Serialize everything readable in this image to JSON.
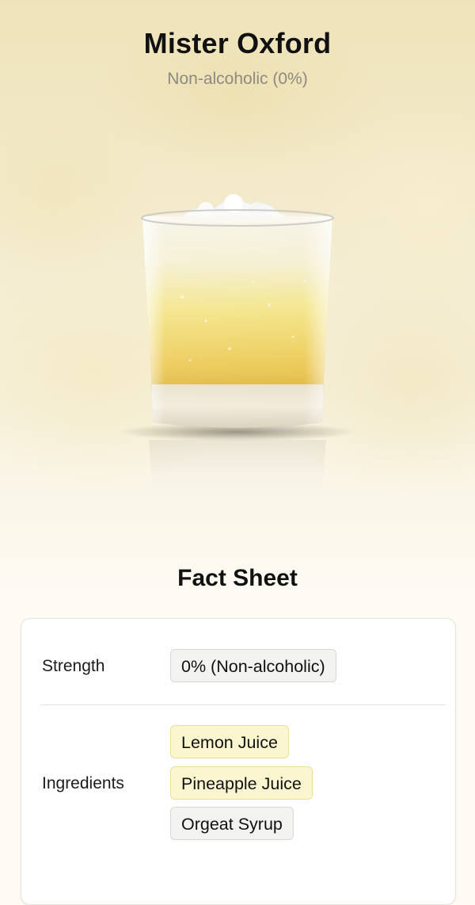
{
  "header": {
    "title": "Mister Oxford",
    "subtitle": "Non-alcoholic (0%)"
  },
  "image": {
    "icon": "cocktail-glass-illustration"
  },
  "fact_sheet": {
    "title": "Fact Sheet",
    "strength": {
      "label": "Strength",
      "value": "0% (Non-alcoholic)"
    },
    "ingredients": {
      "label": "Ingredients",
      "items": [
        {
          "name": "Lemon Juice",
          "highlight": "#fbf6cf"
        },
        {
          "name": "Pineapple Juice",
          "highlight": "#fbf6cf"
        },
        {
          "name": "Orgeat Syrup",
          "highlight": "#f3f3f2"
        }
      ]
    }
  },
  "colors": {
    "drink_top": "#f3f0dc",
    "drink_mid": "#f2d95a",
    "drink_bottom": "#c8901c"
  }
}
